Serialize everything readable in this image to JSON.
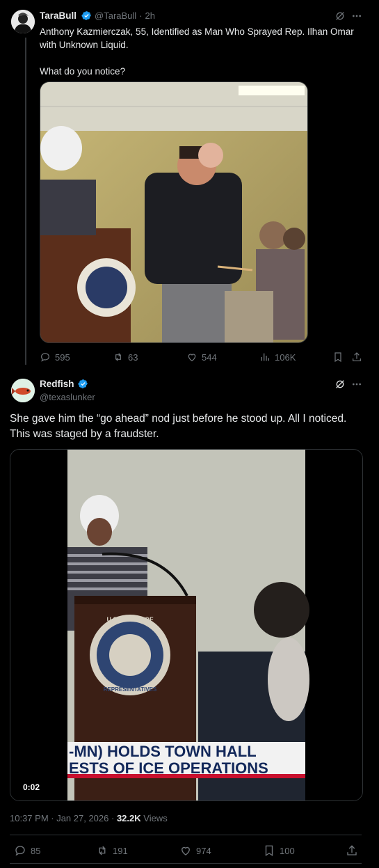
{
  "post1": {
    "name": "TaraBull",
    "handle": "@TaraBull",
    "time": "2h",
    "text_line1": "Anthony Kazmierczak, 55, Identified as Man Who Sprayed Rep. Ilhan Omar",
    "text_line2": "with Unknown Liquid.",
    "text_line3": "What do you notice?",
    "replies": "595",
    "reposts": "63",
    "likes": "544",
    "views": "106K"
  },
  "post2": {
    "name": "Redfish",
    "handle": "@texaslunker",
    "text": "She gave him the “go ahead” nod just before he stood up. All I noticed. This was staged by a fraudster.",
    "video_time": "0:02",
    "chyron_line1": "-MN) HOLDS TOWN HALL",
    "chyron_line2": "ESTS OF ICE OPERATIONS",
    "seal_top": "U.S. HOUSE OF",
    "seal_bottom": "REPRESENTATIVES",
    "timestamp": "10:37 PM · Jan 27, 2026 · ",
    "views_count": "32.2K",
    "views_label": " Views",
    "replies": "85",
    "reposts": "191",
    "likes": "974",
    "bookmarks": "100"
  },
  "colors": {
    "accent": "#1d9bf0",
    "muted": "#71767b",
    "background": "#000000",
    "text": "#e7e9ea"
  }
}
